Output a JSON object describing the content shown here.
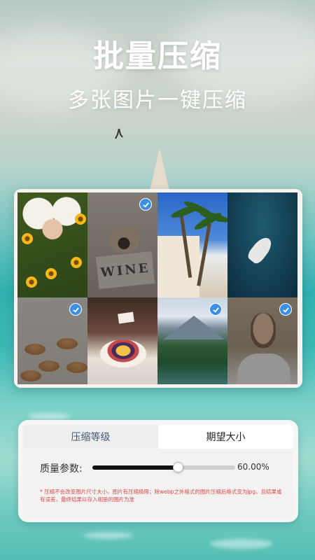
{
  "hero": {
    "title": "批量压缩",
    "subtitle": "多张图片一键压缩"
  },
  "gallery": {
    "images": [
      {
        "subject": "girl-with-flowers",
        "selected": false,
        "overlay": false
      },
      {
        "subject": "pug-wine-box",
        "selected": true,
        "overlay": true
      },
      {
        "subject": "palm-trees-beach",
        "selected": false,
        "overlay": false
      },
      {
        "subject": "boat-aerial",
        "selected": false,
        "overlay": false
      },
      {
        "subject": "croissants",
        "selected": true,
        "overlay": true
      },
      {
        "subject": "acai-bowl",
        "selected": false,
        "overlay": false
      },
      {
        "subject": "mountain-lake",
        "selected": true,
        "overlay": false
      },
      {
        "subject": "smiling-man",
        "selected": true,
        "overlay": true
      }
    ],
    "pug_box_text": "WINE",
    "check_color": "#3b8fe6"
  },
  "controls": {
    "tabs": [
      {
        "label": "压缩等级",
        "active": false
      },
      {
        "label": "期望大小",
        "active": true
      }
    ],
    "quality": {
      "label": "质量参数:",
      "value": 0.6,
      "value_text": "60.00%"
    },
    "note": "* 压缩不会改变图片尺寸大小，图片有压缩极限；除webp之外格式的图片压缩后格式变为jpg，且结果或有误差，最终结果以存入相册的图片为准"
  },
  "colors": {
    "note_red": "#e04848",
    "slider_fill": "#111111"
  }
}
